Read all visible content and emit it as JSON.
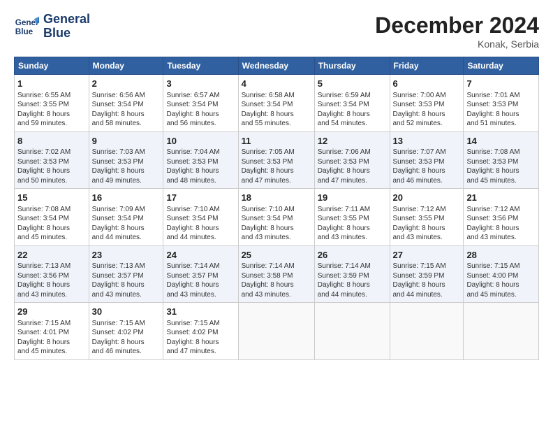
{
  "header": {
    "logo_line1": "General",
    "logo_line2": "Blue",
    "month_title": "December 2024",
    "location": "Konak, Serbia"
  },
  "weekdays": [
    "Sunday",
    "Monday",
    "Tuesday",
    "Wednesday",
    "Thursday",
    "Friday",
    "Saturday"
  ],
  "weeks": [
    [
      {
        "day": "1",
        "info": "Sunrise: 6:55 AM\nSunset: 3:55 PM\nDaylight: 8 hours\nand 59 minutes."
      },
      {
        "day": "2",
        "info": "Sunrise: 6:56 AM\nSunset: 3:54 PM\nDaylight: 8 hours\nand 58 minutes."
      },
      {
        "day": "3",
        "info": "Sunrise: 6:57 AM\nSunset: 3:54 PM\nDaylight: 8 hours\nand 56 minutes."
      },
      {
        "day": "4",
        "info": "Sunrise: 6:58 AM\nSunset: 3:54 PM\nDaylight: 8 hours\nand 55 minutes."
      },
      {
        "day": "5",
        "info": "Sunrise: 6:59 AM\nSunset: 3:54 PM\nDaylight: 8 hours\nand 54 minutes."
      },
      {
        "day": "6",
        "info": "Sunrise: 7:00 AM\nSunset: 3:53 PM\nDaylight: 8 hours\nand 52 minutes."
      },
      {
        "day": "7",
        "info": "Sunrise: 7:01 AM\nSunset: 3:53 PM\nDaylight: 8 hours\nand 51 minutes."
      }
    ],
    [
      {
        "day": "8",
        "info": "Sunrise: 7:02 AM\nSunset: 3:53 PM\nDaylight: 8 hours\nand 50 minutes."
      },
      {
        "day": "9",
        "info": "Sunrise: 7:03 AM\nSunset: 3:53 PM\nDaylight: 8 hours\nand 49 minutes."
      },
      {
        "day": "10",
        "info": "Sunrise: 7:04 AM\nSunset: 3:53 PM\nDaylight: 8 hours\nand 48 minutes."
      },
      {
        "day": "11",
        "info": "Sunrise: 7:05 AM\nSunset: 3:53 PM\nDaylight: 8 hours\nand 47 minutes."
      },
      {
        "day": "12",
        "info": "Sunrise: 7:06 AM\nSunset: 3:53 PM\nDaylight: 8 hours\nand 47 minutes."
      },
      {
        "day": "13",
        "info": "Sunrise: 7:07 AM\nSunset: 3:53 PM\nDaylight: 8 hours\nand 46 minutes."
      },
      {
        "day": "14",
        "info": "Sunrise: 7:08 AM\nSunset: 3:53 PM\nDaylight: 8 hours\nand 45 minutes."
      }
    ],
    [
      {
        "day": "15",
        "info": "Sunrise: 7:08 AM\nSunset: 3:54 PM\nDaylight: 8 hours\nand 45 minutes."
      },
      {
        "day": "16",
        "info": "Sunrise: 7:09 AM\nSunset: 3:54 PM\nDaylight: 8 hours\nand 44 minutes."
      },
      {
        "day": "17",
        "info": "Sunrise: 7:10 AM\nSunset: 3:54 PM\nDaylight: 8 hours\nand 44 minutes."
      },
      {
        "day": "18",
        "info": "Sunrise: 7:10 AM\nSunset: 3:54 PM\nDaylight: 8 hours\nand 43 minutes."
      },
      {
        "day": "19",
        "info": "Sunrise: 7:11 AM\nSunset: 3:55 PM\nDaylight: 8 hours\nand 43 minutes."
      },
      {
        "day": "20",
        "info": "Sunrise: 7:12 AM\nSunset: 3:55 PM\nDaylight: 8 hours\nand 43 minutes."
      },
      {
        "day": "21",
        "info": "Sunrise: 7:12 AM\nSunset: 3:56 PM\nDaylight: 8 hours\nand 43 minutes."
      }
    ],
    [
      {
        "day": "22",
        "info": "Sunrise: 7:13 AM\nSunset: 3:56 PM\nDaylight: 8 hours\nand 43 minutes."
      },
      {
        "day": "23",
        "info": "Sunrise: 7:13 AM\nSunset: 3:57 PM\nDaylight: 8 hours\nand 43 minutes."
      },
      {
        "day": "24",
        "info": "Sunrise: 7:14 AM\nSunset: 3:57 PM\nDaylight: 8 hours\nand 43 minutes."
      },
      {
        "day": "25",
        "info": "Sunrise: 7:14 AM\nSunset: 3:58 PM\nDaylight: 8 hours\nand 43 minutes."
      },
      {
        "day": "26",
        "info": "Sunrise: 7:14 AM\nSunset: 3:59 PM\nDaylight: 8 hours\nand 44 minutes."
      },
      {
        "day": "27",
        "info": "Sunrise: 7:15 AM\nSunset: 3:59 PM\nDaylight: 8 hours\nand 44 minutes."
      },
      {
        "day": "28",
        "info": "Sunrise: 7:15 AM\nSunset: 4:00 PM\nDaylight: 8 hours\nand 45 minutes."
      }
    ],
    [
      {
        "day": "29",
        "info": "Sunrise: 7:15 AM\nSunset: 4:01 PM\nDaylight: 8 hours\nand 45 minutes."
      },
      {
        "day": "30",
        "info": "Sunrise: 7:15 AM\nSunset: 4:02 PM\nDaylight: 8 hours\nand 46 minutes."
      },
      {
        "day": "31",
        "info": "Sunrise: 7:15 AM\nSunset: 4:02 PM\nDaylight: 8 hours\nand 47 minutes."
      },
      {
        "day": "",
        "info": ""
      },
      {
        "day": "",
        "info": ""
      },
      {
        "day": "",
        "info": ""
      },
      {
        "day": "",
        "info": ""
      }
    ]
  ]
}
